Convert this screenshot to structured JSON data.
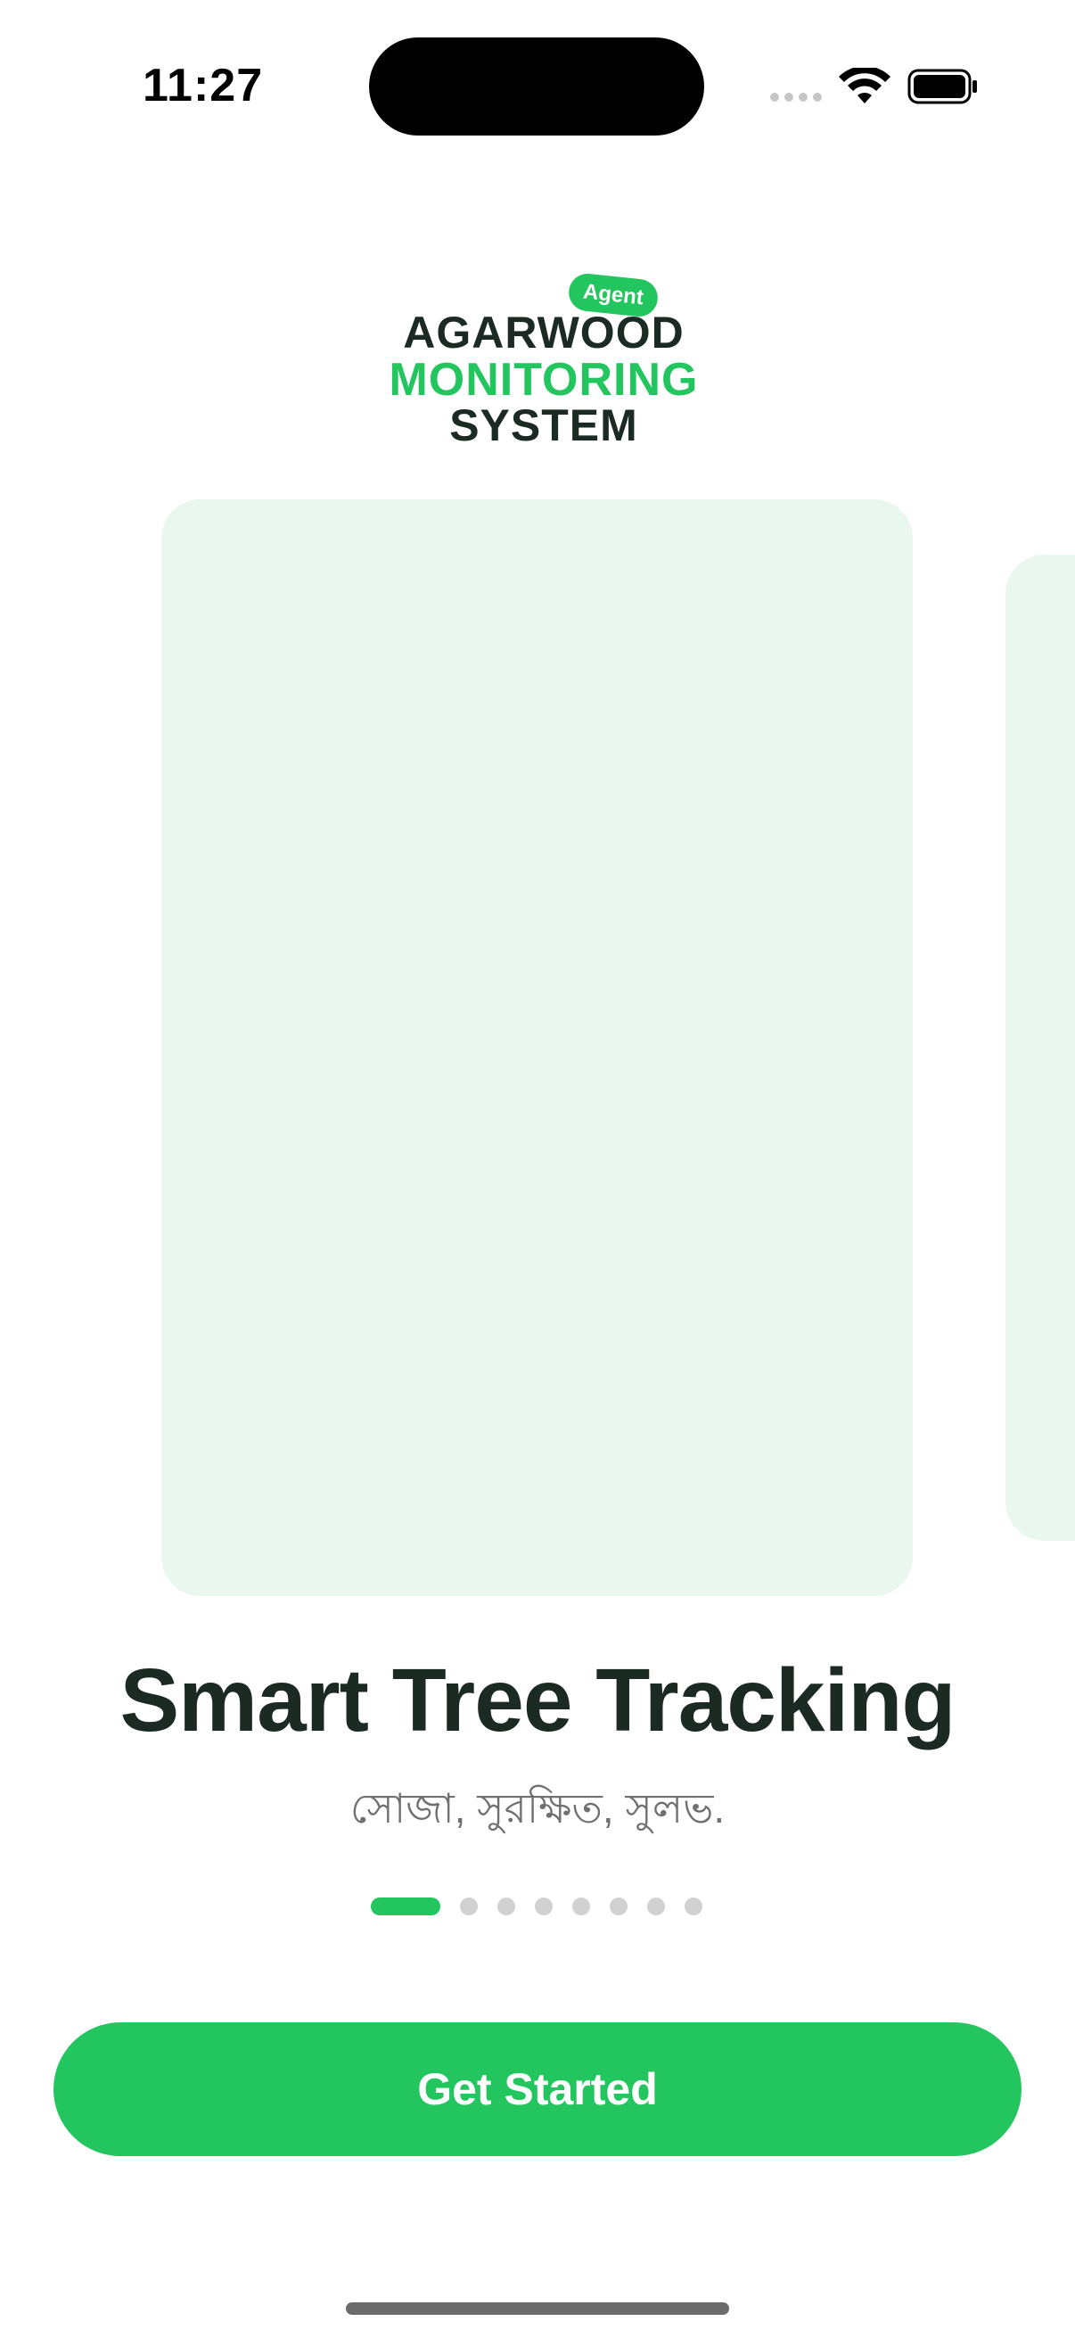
{
  "status_bar": {
    "time": "11:27",
    "icons": [
      "signal-dots-icon",
      "wifi-icon",
      "battery-icon"
    ]
  },
  "logo": {
    "badge": "Agent",
    "line1": "AGARWOOD",
    "line2": "MONITORING",
    "line3": "SYSTEM"
  },
  "carousel": {
    "title": "Smart Tree Tracking",
    "subtitle": "সোজা, সুরক্ষিত, সুলভ.",
    "page_count": 8,
    "active_index": 0
  },
  "cta": {
    "label": "Get Started"
  },
  "colors": {
    "accent": "#22c55e",
    "card_bg": "#e9f7ef",
    "title_text": "#1c2a24",
    "subtitle_text": "#707070",
    "dot_inactive": "#d1d1d1"
  }
}
